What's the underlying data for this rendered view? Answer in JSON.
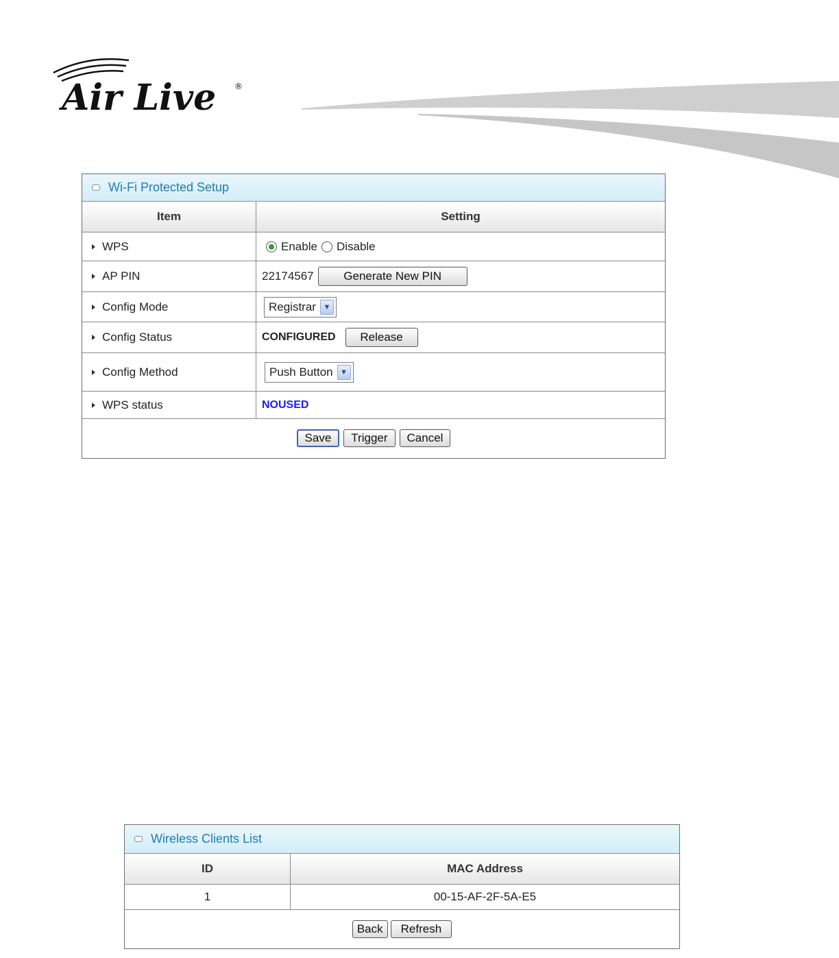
{
  "wps_panel": {
    "title": "Wi-Fi Protected Setup",
    "headers": {
      "item": "Item",
      "setting": "Setting"
    },
    "rows": {
      "wps": {
        "label": "WPS",
        "enable": "Enable",
        "disable": "Disable",
        "selected": "Enable"
      },
      "ap_pin": {
        "label": "AP PIN",
        "value": "22174567",
        "button": "Generate New PIN"
      },
      "config_mode": {
        "label": "Config Mode",
        "selected": "Registrar"
      },
      "config_status": {
        "label": "Config Status",
        "value": "CONFIGURED",
        "button": "Release"
      },
      "config_method": {
        "label": "Config Method",
        "selected": "Push Button"
      },
      "wps_status": {
        "label": "WPS status",
        "value": "NOUSED",
        "value_color": "#1a1aff"
      }
    },
    "buttons": {
      "save": "Save",
      "trigger": "Trigger",
      "cancel": "Cancel"
    }
  },
  "clients_panel": {
    "title": "Wireless Clients List",
    "headers": {
      "id": "ID",
      "mac": "MAC Address"
    },
    "rows": [
      {
        "id": "1",
        "mac": "00-15-AF-2F-5A-E5"
      }
    ],
    "buttons": {
      "back": "Back",
      "refresh": "Refresh"
    }
  },
  "colors": {
    "title_text": "#1f7db5",
    "title_bg": "#d4edf8"
  }
}
